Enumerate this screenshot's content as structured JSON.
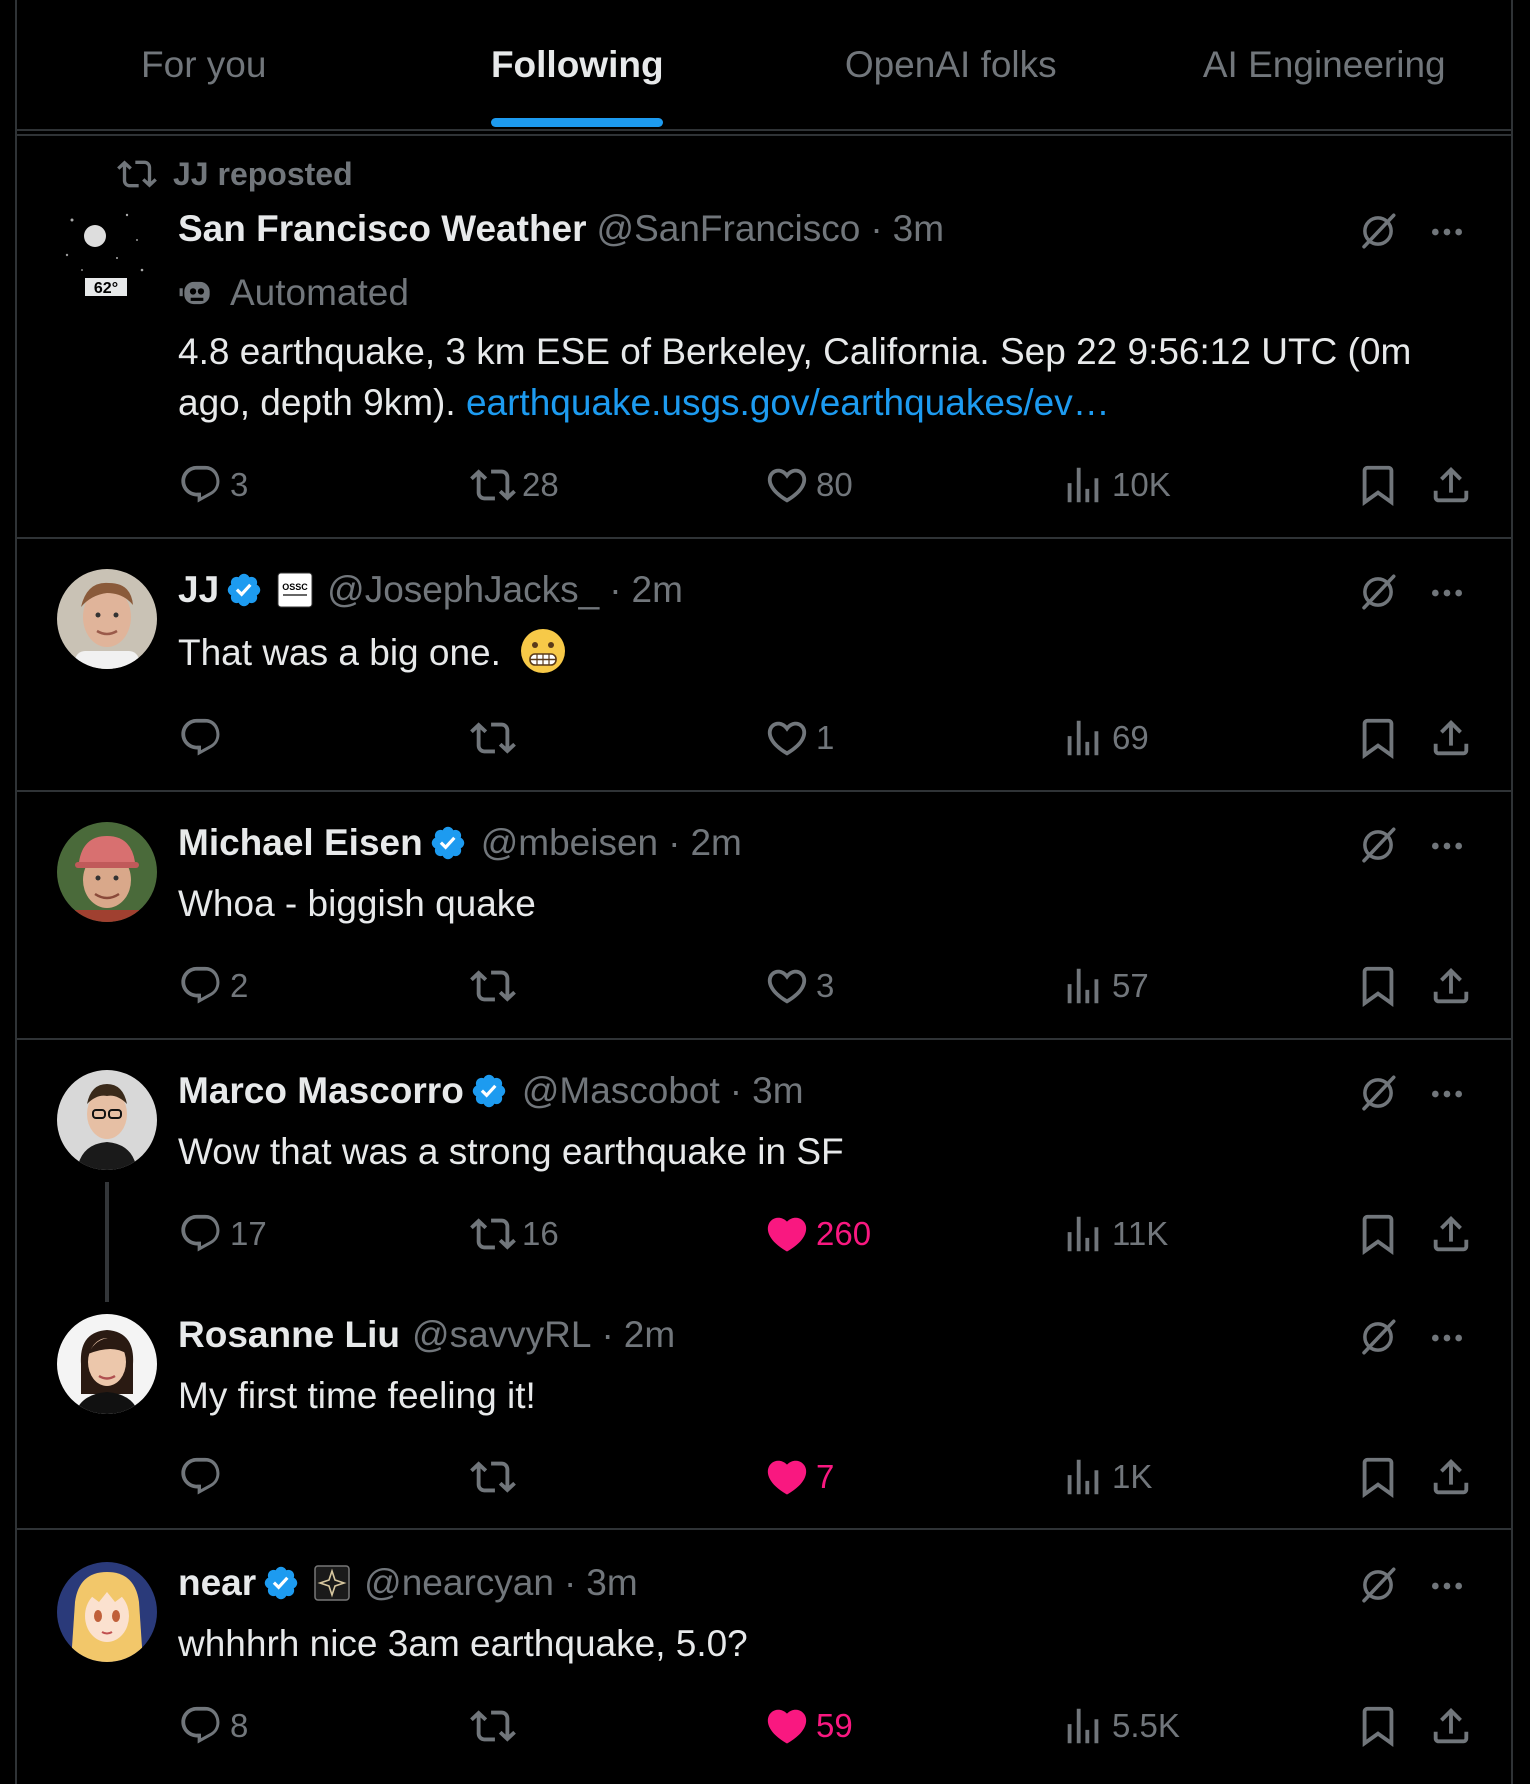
{
  "tabs": [
    {
      "label": "For you",
      "active": false
    },
    {
      "label": "Following",
      "active": true
    },
    {
      "label": "OpenAI folks",
      "active": false
    },
    {
      "label": "AI Engineering",
      "active": false
    }
  ],
  "posts": [
    {
      "repost_label": "JJ reposted",
      "name": "San Francisco Weather",
      "handle": "@SanFrancisco",
      "time": "3m",
      "automated_label": "Automated",
      "avatar_badge": "62°",
      "text": "4.8 earthquake, 3 km ESE of Berkeley, California. Sep 22 9:56:12 UTC (0m ago, depth 9km).",
      "link_text": "earthquake.usgs.gov/earthquakes/ev…",
      "replies": "3",
      "reposts": "28",
      "likes": "80",
      "views": "10K",
      "liked": false
    },
    {
      "name": "JJ",
      "handle": "@JosephJacks_",
      "time": "2m",
      "verified": true,
      "affiliation_badge": "OSSC",
      "text": "That was a big one.",
      "emoji": "grimacing-face",
      "replies": "",
      "reposts": "",
      "likes": "1",
      "views": "69",
      "liked": false
    },
    {
      "name": "Michael Eisen",
      "handle": "@mbeisen",
      "time": "2m",
      "verified": true,
      "text": "Whoa - biggish quake",
      "replies": "2",
      "reposts": "",
      "likes": "3",
      "views": "57",
      "liked": false
    },
    {
      "name": "Marco Mascorro",
      "handle": "@Mascobot",
      "time": "3m",
      "verified": true,
      "text": "Wow that was a strong earthquake in SF",
      "replies": "17",
      "reposts": "16",
      "likes": "260",
      "views": "11K",
      "liked": true
    },
    {
      "name": "Rosanne Liu",
      "handle": "@savvyRL",
      "time": "2m",
      "verified": false,
      "text": "My first time feeling it!",
      "replies": "",
      "reposts": "",
      "likes": "7",
      "views": "1K",
      "liked": true
    },
    {
      "name": "near",
      "handle": "@nearcyan",
      "time": "3m",
      "verified": true,
      "affiliation_badge": "sparkle",
      "text": "whhhrh nice 3am earthquake, 5.0?",
      "replies": "8",
      "reposts": "",
      "likes": "59",
      "views": "5.5K",
      "liked": true
    }
  ],
  "meta_separator": "·",
  "colors": {
    "accent": "#1d9bf0",
    "like": "#f91880",
    "muted": "#71767b",
    "border": "#2f3336"
  }
}
